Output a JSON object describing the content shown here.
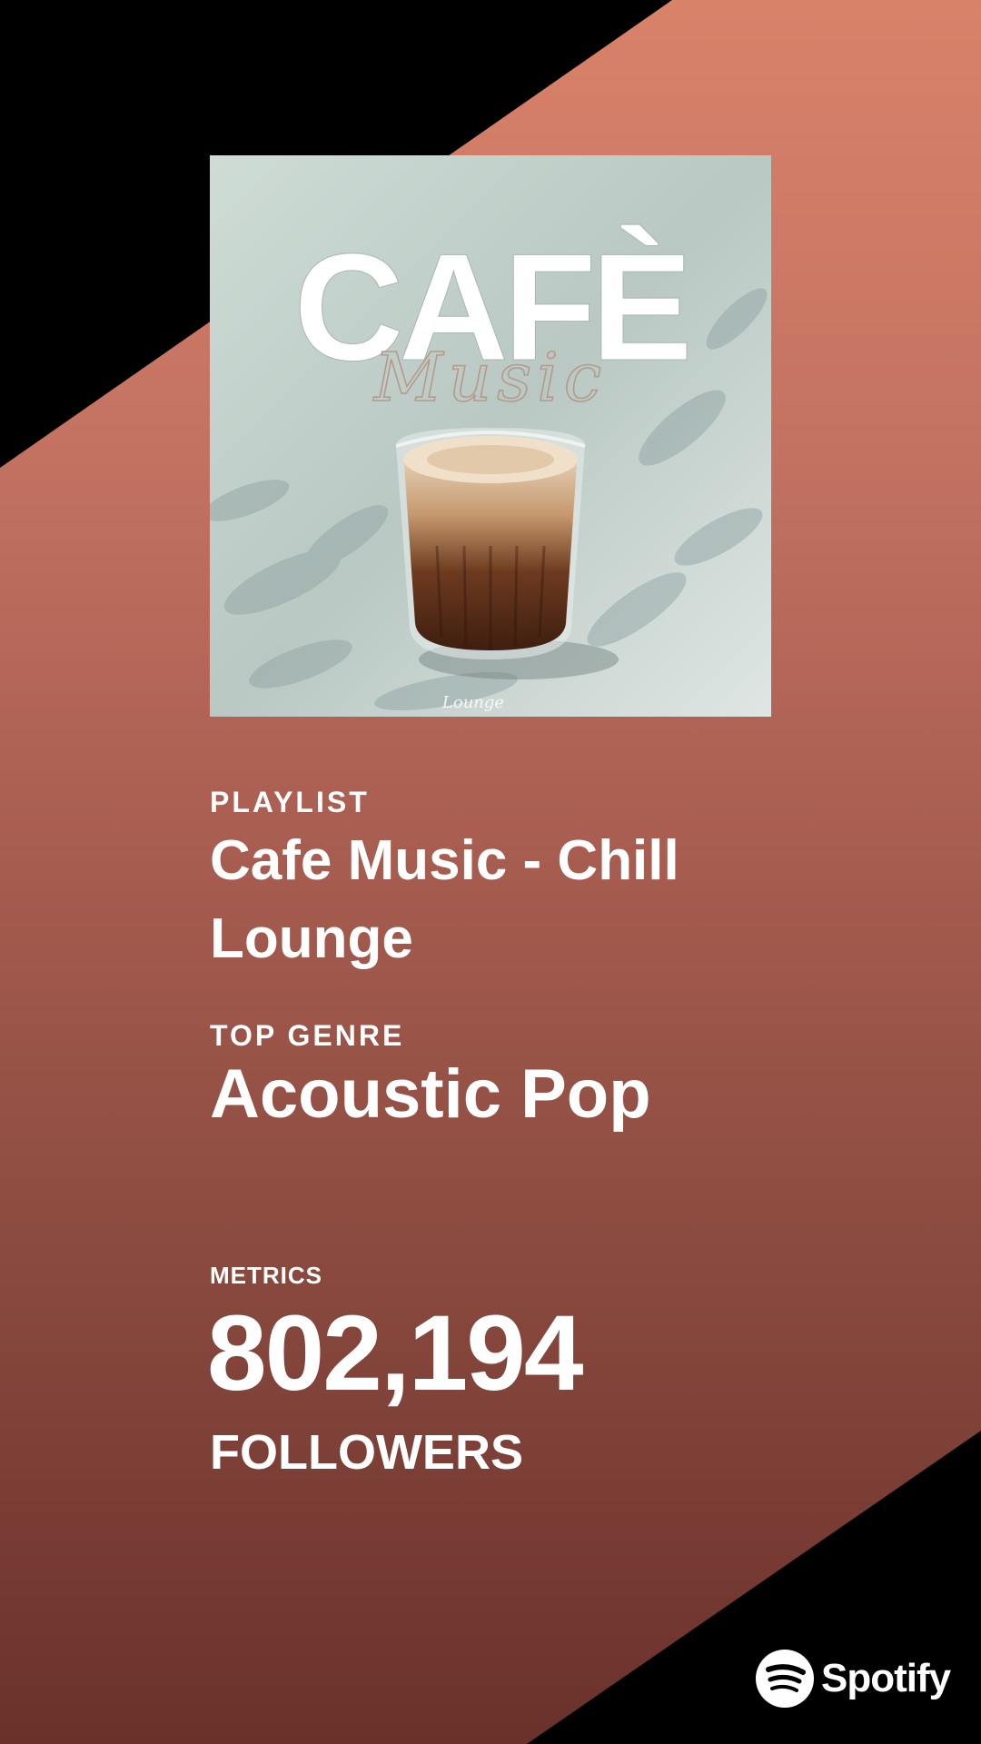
{
  "cover": {
    "headline": "CAFÈ",
    "script_word": "Music",
    "signature": "Lounge"
  },
  "playlist": {
    "section_label": "PLAYLIST",
    "name": "Cafe Music - Chill Lounge"
  },
  "genre": {
    "section_label": "TOP GENRE",
    "value": "Acoustic Pop"
  },
  "metrics": {
    "section_label": "METRICS",
    "value": "802,194",
    "unit": "FOLLOWERS"
  },
  "brand": {
    "name": "Spotify",
    "icon": "spotify-icon"
  },
  "colors": {
    "background_top": "#d9826a",
    "background_bottom": "#6a312b",
    "corner": "#000000",
    "text": "#ffffff"
  }
}
